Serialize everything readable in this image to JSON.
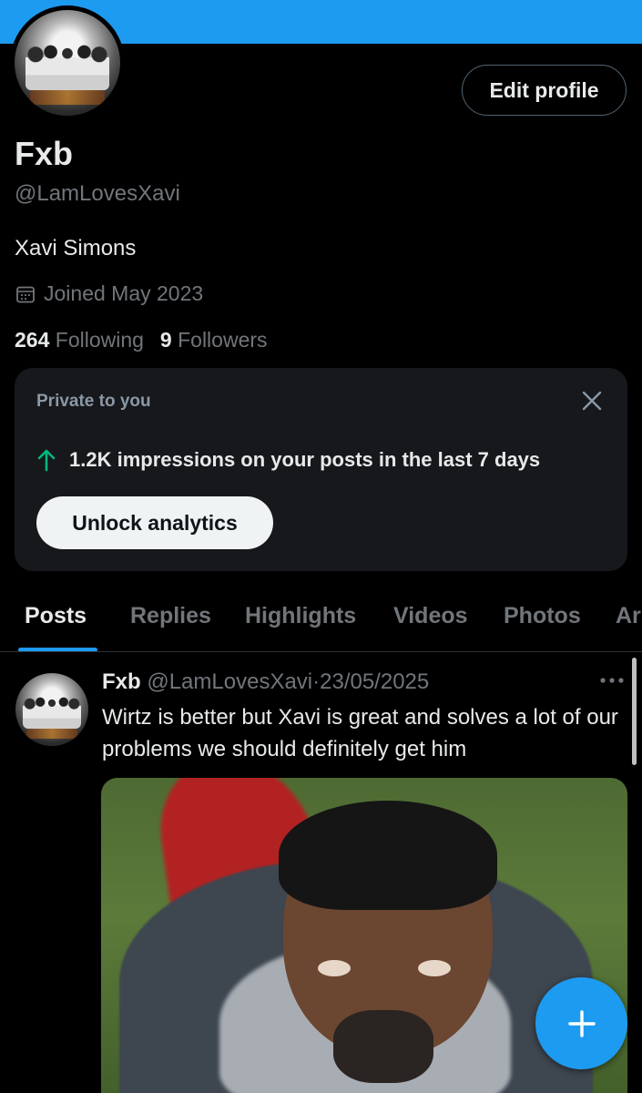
{
  "profile": {
    "name": "Fxb",
    "handle": "@LamLovesXavi",
    "bio": "Xavi Simons",
    "joined": "Joined May 2023",
    "following_count": "264",
    "following_label": "Following",
    "followers_count": "9",
    "followers_label": "Followers",
    "edit_button": "Edit profile"
  },
  "analytics_card": {
    "header": "Private to you",
    "impressions_text": "1.2K impressions on your posts in the last 7 days",
    "button": "Unlock analytics"
  },
  "tabs": [
    {
      "label": "Posts",
      "active": true
    },
    {
      "label": "Replies",
      "active": false
    },
    {
      "label": "Highlights",
      "active": false
    },
    {
      "label": "Videos",
      "active": false
    },
    {
      "label": "Photos",
      "active": false
    },
    {
      "label": "Ar",
      "active": false
    }
  ],
  "post": {
    "author_name": "Fxb",
    "author_handle": "@LamLovesXavi",
    "separator": "·",
    "date": "23/05/2025",
    "text": "Wirtz is better but Xavi is great and solves a lot of our problems we should definitely get him"
  },
  "icons": {
    "calendar": "calendar-icon",
    "close": "close-icon",
    "arrow_up": "arrow-up-icon",
    "more": "more-icon",
    "compose": "plus-icon"
  },
  "colors": {
    "accent": "#1d9bf0",
    "background": "#000000",
    "muted_text": "#71767b",
    "impressions_arrow": "#00ba7c"
  }
}
